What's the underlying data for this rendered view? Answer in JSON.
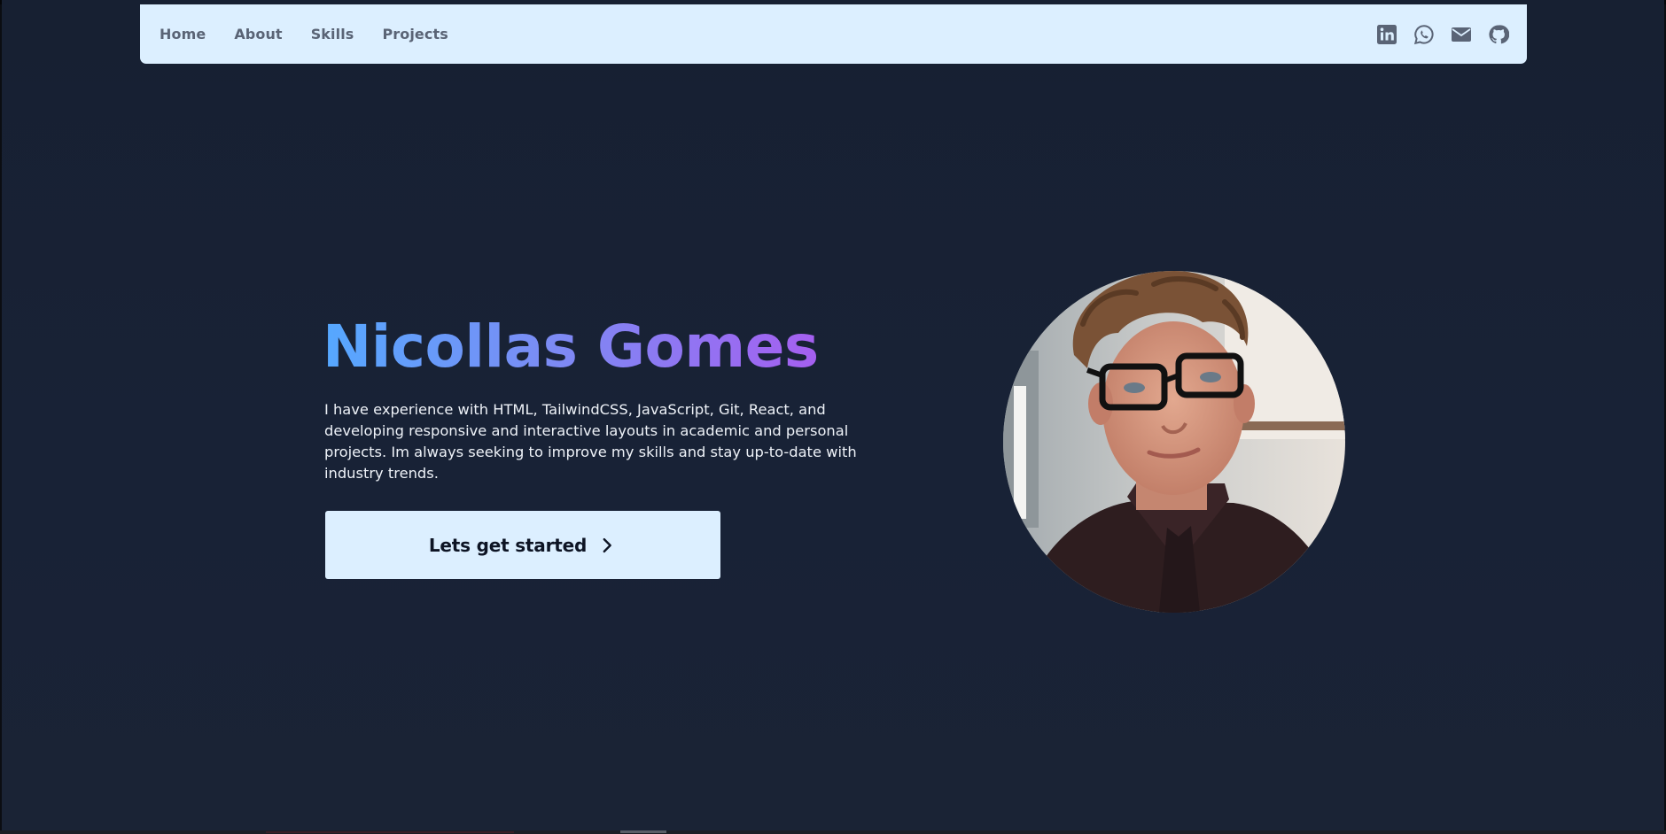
{
  "nav": {
    "links": [
      {
        "label": "Home"
      },
      {
        "label": "About"
      },
      {
        "label": "Skills"
      },
      {
        "label": "Projects"
      }
    ],
    "icons": [
      "linkedin-icon",
      "whatsapp-icon",
      "mail-icon",
      "github-icon"
    ]
  },
  "hero": {
    "name": "Nicollas Gomes",
    "description": "I have experience with HTML, TailwindCSS, JavaScript, Git, React, and developing responsive and interactive layouts in academic and personal projects. Im always seeking to improve my skills and stay up-to-date with industry trends.",
    "cta_label": "Lets get started",
    "cta_icon": "chevron-right-icon"
  },
  "colors": {
    "background": "#182236",
    "navbar": "#dcefff",
    "nav_text": "#5a6476",
    "gradient_start": "#55a8ff",
    "gradient_end": "#a55ff0"
  }
}
